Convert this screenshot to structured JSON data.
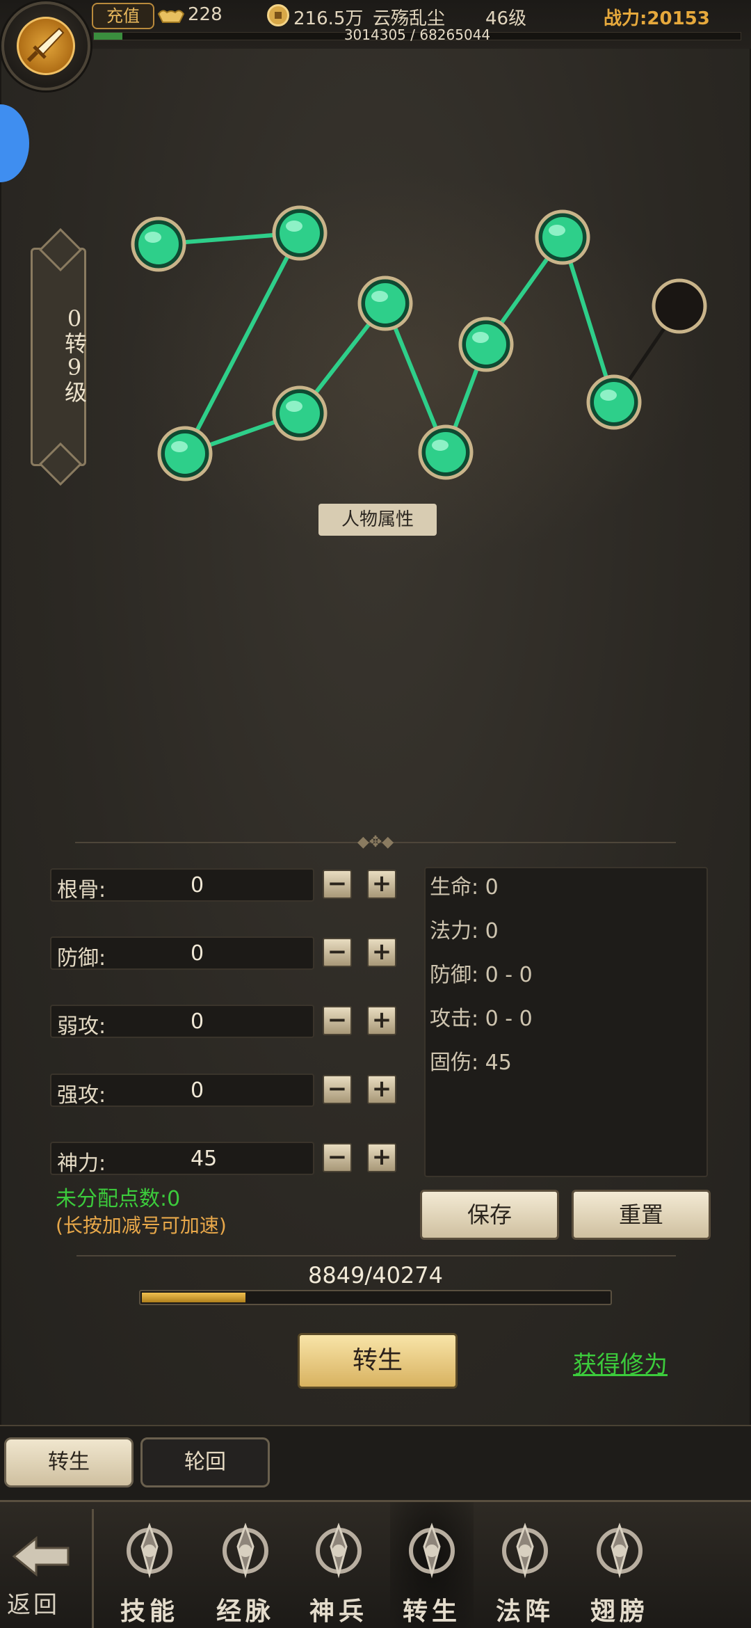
{
  "topbar": {
    "recharge_label": "充值",
    "ingot_count": "228",
    "coin_amount": "216.5万",
    "player_name": "云殇乱尘",
    "level": "46级",
    "power_label": "战力:",
    "power_value": "20153",
    "exp_text": "3014305 / 68265044",
    "exp_fraction": 0.044
  },
  "badge": {
    "text": "0转9级"
  },
  "constellation": {
    "active_color": "#2ecf8a",
    "lit_nodes": 9,
    "total_nodes": 10
  },
  "section_title": "人物属性",
  "stats": [
    {
      "label": "根骨:",
      "value": "0"
    },
    {
      "label": "防御:",
      "value": "0"
    },
    {
      "label": "弱攻:",
      "value": "0"
    },
    {
      "label": "强攻:",
      "value": "0"
    },
    {
      "label": "神力:",
      "value": "45"
    }
  ],
  "buttons": {
    "minus": "−",
    "plus": "+"
  },
  "results": [
    "生命: 0",
    "法力: 0",
    "防御: 0 - 0",
    "攻击: 0 - 0",
    "固伤: 45"
  ],
  "unallocated": "未分配点数:0",
  "hint": "(长按加减号可加速)",
  "save_label": "保存",
  "reset_label": "重置",
  "progress": {
    "text": "8849/40274",
    "fraction": 0.22
  },
  "rebirth_label": "转生",
  "get_cultivation": "获得修为",
  "subtabs": [
    "转生",
    "轮回"
  ],
  "nav": {
    "back": "返回",
    "items": [
      "技能",
      "经脉",
      "神兵",
      "转生",
      "法阵",
      "翅膀"
    ],
    "active": "转生"
  },
  "colors": {
    "gold": "#e6a93c",
    "green": "#3ccb3c",
    "jade": "#2ecf8a"
  }
}
